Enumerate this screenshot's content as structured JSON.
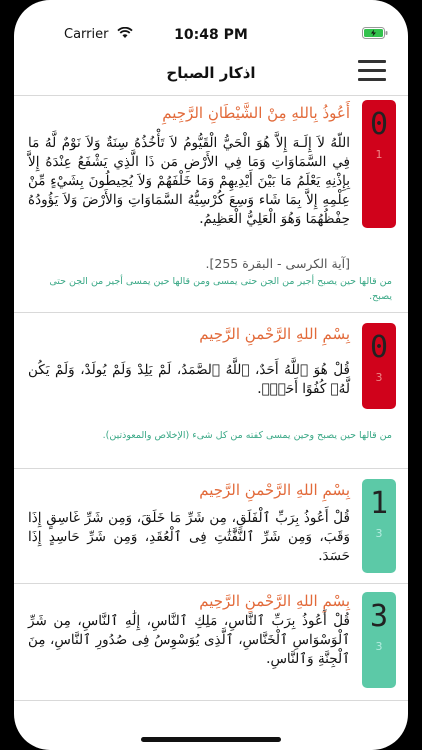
{
  "status_bar": {
    "carrier": "Carrier",
    "time": "10:48 PM",
    "battery_color": "#33c24d"
  },
  "nav": {
    "title": "اذكار الصباح",
    "menu_icon": "hamburger-menu-icon"
  },
  "colors": {
    "counter_active": "#d0021b",
    "counter_done": "#5cc9a7",
    "heading": "#e26a3a",
    "virtue": "#3aa886"
  },
  "cards": [
    {
      "heading": "أَعُوذُ بِاللهِ مِنْ الشَّيْطَانِ الرَّجِيمِ",
      "body": "اللّهُ لاَ إِلَـهَ إِلاَّ هُوَ الْحَيُّ الْقَيُّومُ لاَ تَأْخُذُهُ سِنَةٌ وَلاَ نَوْمٌ لَّهُ مَا فِي السَّمَاوَاتِ وَمَا فِي الأَرْضِ مَن ذَا الَّذِي يَشْفَعُ عِنْدَهُ إِلاَّ بِإِذْنِهِ يَعْلَمُ مَا بَيْنَ أَيْدِيهِمْ وَمَا خَلْفَهُمْ وَلاَ يُحِيطُونَ بِشَيْءٍ مِّنْ عِلْمِهِ إِلاَّ بِمَا شَاء وَسِعَ كُرْسِيُّهُ السَّمَاوَاتِ وَالأَرْضَ وَلاَ يَؤُودُهُ حِفْظُهُمَا وَهُوَ الْعَلِيُّ الْعَظِيمُ.",
      "reference": "[آية الكرسى - البقرة 255].",
      "virtue": "من قالها حين يصبح أجير من الجن حتى يمسى ومن قالها حين يمسى أجير من الجن حتى يصبح.",
      "count": "0",
      "repetitions": "1",
      "state": "active"
    },
    {
      "heading": "بِسْمِ اللهِ الرَّحْمنِ الرَّحِيم",
      "body": "قُلْ هُوَ ٱللَّهُ أَحَدٌ، ٱللَّهُ ٱلصَّمَدُ، لَمْ يَلِدْ وَلَمْ يُولَدْ، وَلَمْ يَكُن لَّهُۥ كُفُوًا أَحَدٌۢ.",
      "reference": "",
      "virtue": "من قالها حين يصبح وحين يمسى كفته من كل شىء (الإخلاص والمعوذتين).",
      "count": "0",
      "repetitions": "3",
      "state": "active"
    },
    {
      "heading": "بِسْمِ اللهِ الرَّحْمنِ الرَّحِيم",
      "body": "قُلْ أَعُوذُ بِرَبِّ ٱلْفَلَقِ، مِن شَرِّ مَا خَلَقَ، وَمِن شَرِّ غَاسِقٍ إِذَا وَقَبَ، وَمِن شَرِّ ٱلنَّفَّٰثَٰتِ فِى ٱلْعُقَدِ، وَمِن شَرِّ حَاسِدٍ إِذَا حَسَدَ.",
      "reference": "",
      "virtue": "",
      "count": "1",
      "repetitions": "3",
      "state": "done"
    },
    {
      "heading": "بِسْمِ اللهِ الرَّحْمنِ الرَّحِيم",
      "body": "قُلْ أَعُوذُ بِرَبِّ ٱلنَّاسِ، مَلِكِ ٱلنَّاسِ، إِلَٰهِ ٱلنَّاسِ، مِن شَرِّ ٱلْوَسْوَاسِ ٱلْخَنَّاسِ، ٱلَّذِى يُوَسْوِسُ فِى صُدُورِ ٱلنَّاسِ، مِنَ ٱلْجِنَّةِ وَٱلنَّاسِ.",
      "reference": "",
      "virtue": "",
      "count": "3",
      "repetitions": "3",
      "state": "done"
    }
  ]
}
